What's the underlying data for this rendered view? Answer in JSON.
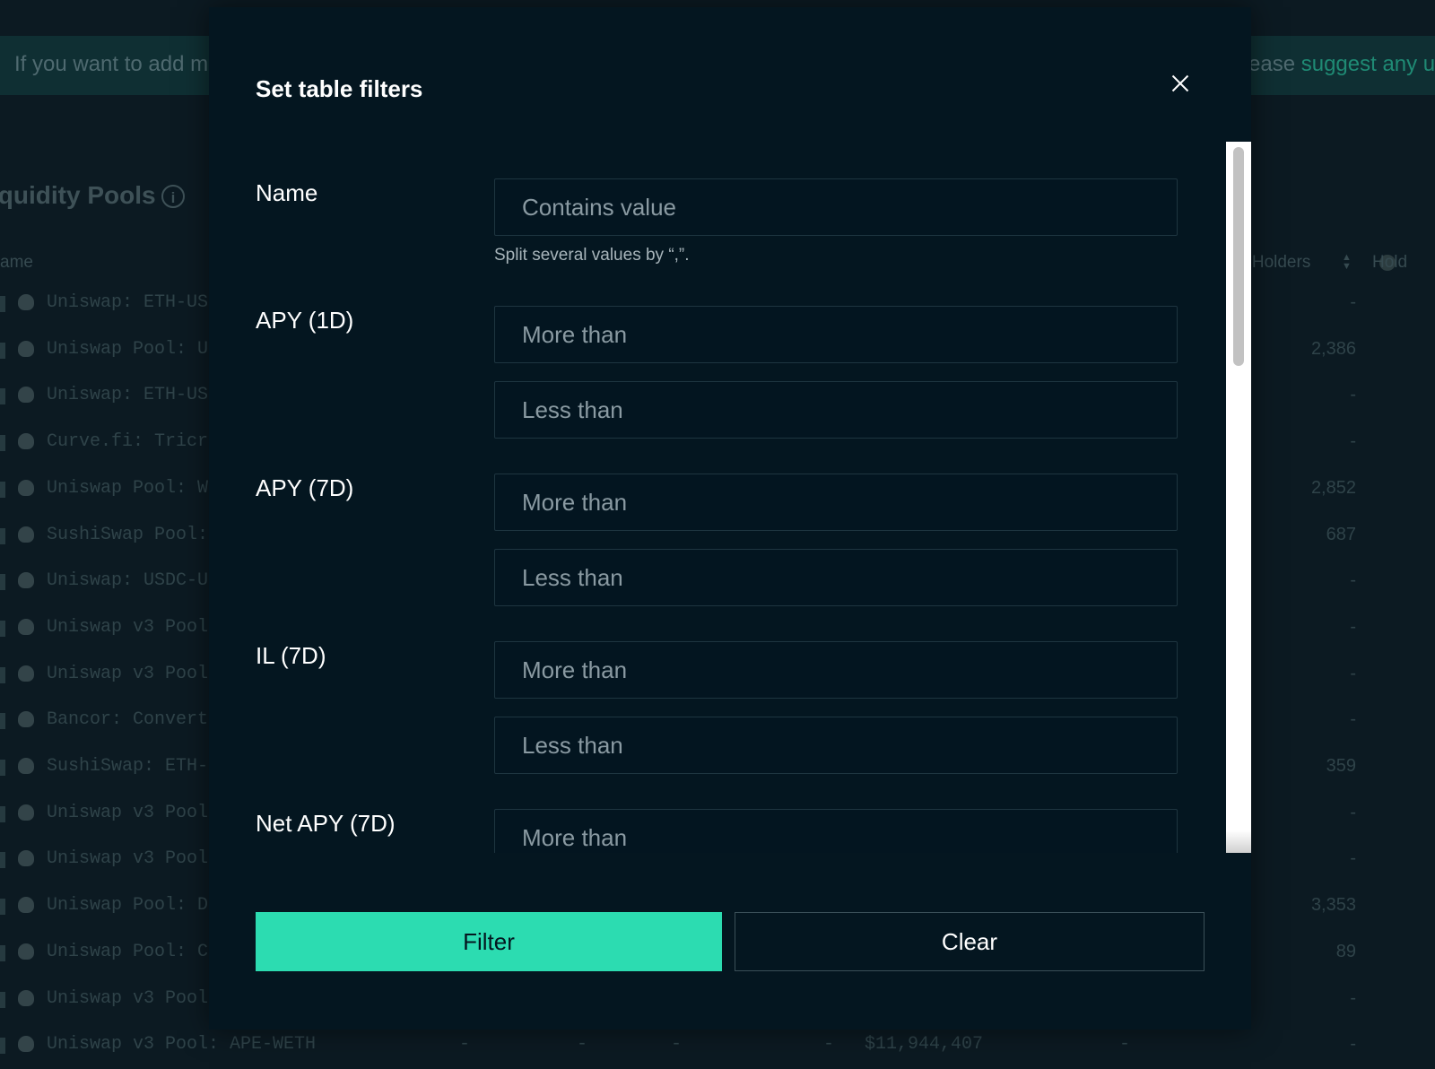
{
  "background": {
    "notice_left": "If you want to add m",
    "notice_right_prefix": "ease ",
    "notice_right_link": "suggest any u",
    "section_title": "iquidity Pools",
    "col_name": "ame",
    "col_holders": "n Holders",
    "col_hold": "Hold",
    "rows": [
      {
        "name": "Uniswap: ETH-USI",
        "holders": "-"
      },
      {
        "name": "Uniswap Pool: U:",
        "holders": "2,386"
      },
      {
        "name": "Uniswap: ETH-USI",
        "holders": "-"
      },
      {
        "name": "Curve.fi: Tricr",
        "holders": "-"
      },
      {
        "name": "Uniswap Pool: WI",
        "holders": "2,852"
      },
      {
        "name": "SushiSwap Pool:",
        "holders": "687"
      },
      {
        "name": "Uniswap: USDC-U:",
        "holders": "-"
      },
      {
        "name": "Uniswap v3 Pool",
        "holders": "-"
      },
      {
        "name": "Uniswap v3 Pool",
        "holders": "-"
      },
      {
        "name": "Bancor: Convert",
        "holders": "-"
      },
      {
        "name": "SushiSwap: ETH-I",
        "holders": "359"
      },
      {
        "name": "Uniswap v3 Pool",
        "holders": "-"
      },
      {
        "name": "Uniswap v3 Pool",
        "holders": "-"
      },
      {
        "name": "Uniswap Pool: D.",
        "holders": "3,353"
      },
      {
        "name": "Uniswap Pool: Cl",
        "holders": "89"
      },
      {
        "name": "Uniswap v3 Pool",
        "holders": "-"
      },
      {
        "name": "Uniswap v3 Pool: APE-WETH",
        "holders": "-"
      }
    ],
    "last_row_cells": [
      "-",
      "-",
      "-",
      "-",
      "$11,944,407",
      "-"
    ]
  },
  "modal": {
    "title": "Set table filters",
    "filters": [
      {
        "label": "Name",
        "inputs": [
          {
            "placeholder": "Contains value"
          }
        ],
        "helper": "Split several values by “,”."
      },
      {
        "label": "APY (1D)",
        "inputs": [
          {
            "placeholder": "More than"
          },
          {
            "placeholder": "Less than"
          }
        ]
      },
      {
        "label": "APY (7D)",
        "inputs": [
          {
            "placeholder": "More than"
          },
          {
            "placeholder": "Less than"
          }
        ]
      },
      {
        "label": "IL (7D)",
        "inputs": [
          {
            "placeholder": "More than"
          },
          {
            "placeholder": "Less than"
          }
        ]
      },
      {
        "label": "Net APY (7D)",
        "inputs": [
          {
            "placeholder": "More than"
          }
        ]
      }
    ],
    "filter_button": "Filter",
    "clear_button": "Clear"
  },
  "colors": {
    "accent": "#2cdcb1",
    "modal_bg": "#041620",
    "input_border": "#1e3540"
  }
}
